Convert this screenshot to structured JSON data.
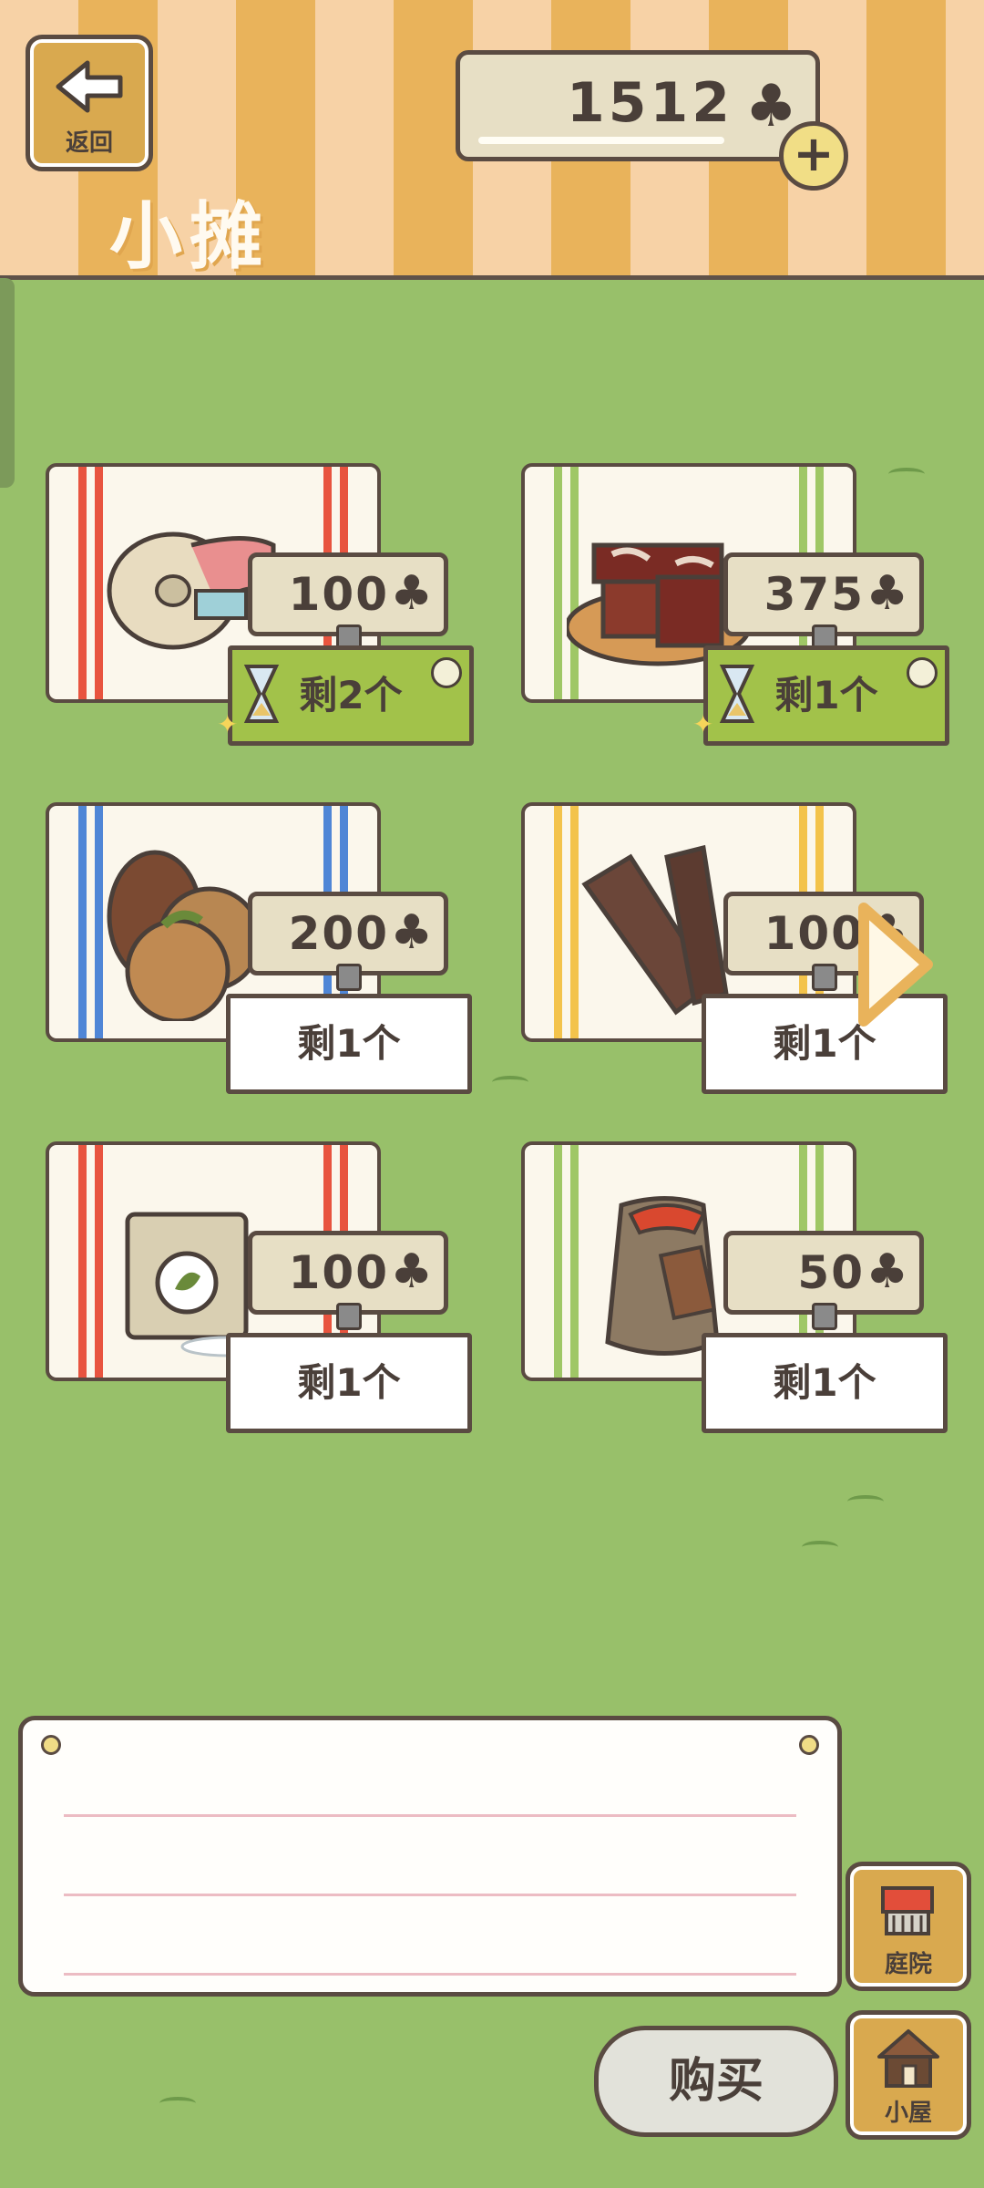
{
  "header": {
    "back_label": "返回",
    "title": "小摊",
    "clovers": "1512",
    "clover_symbol": "♣",
    "plus": "+"
  },
  "items": [
    {
      "name": "ribbon-bundle",
      "price": "100",
      "stock": "剩2个",
      "limited": true,
      "stripe": "#e8543f"
    },
    {
      "name": "yokan-plate",
      "price": "375",
      "stock": "剩1个",
      "limited": true,
      "stripe": "#9fc766"
    },
    {
      "name": "pinecone-chestnut",
      "price": "200",
      "stock": "剩1个",
      "limited": false,
      "stripe": "#4f86d6"
    },
    {
      "name": "dried-wood",
      "price": "100",
      "stock": "剩1个",
      "limited": false,
      "stripe": "#f3c34b"
    },
    {
      "name": "seed-bag",
      "price": "100",
      "stock": "剩1个",
      "limited": false,
      "stripe": "#e8543f"
    },
    {
      "name": "lucky-pouch",
      "price": "50",
      "stock": "剩1个",
      "limited": false,
      "stripe": "#9fc766"
    }
  ],
  "footer": {
    "buy_label": "购买",
    "yard_label": "庭院",
    "house_label": "小屋"
  }
}
